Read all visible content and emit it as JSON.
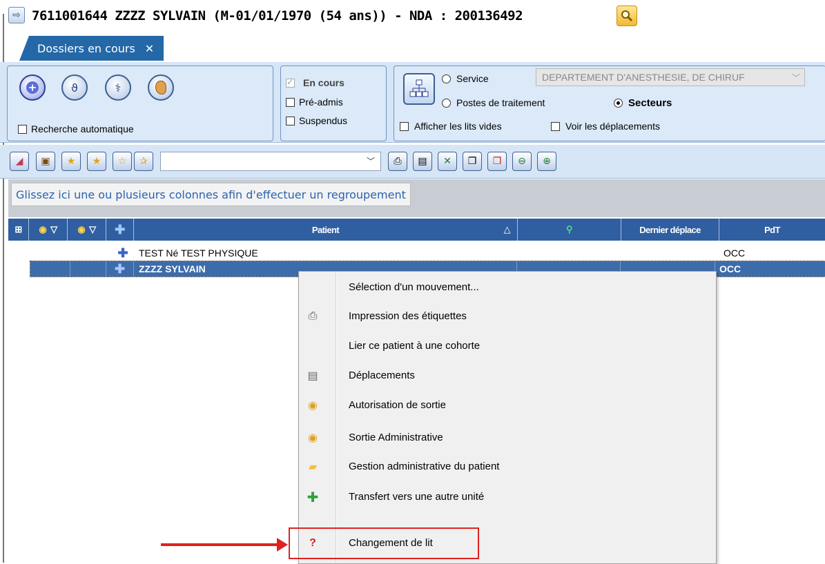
{
  "header": {
    "title": "7611001644 ZZZZ SYLVAIN (M-01/01/1970 (54 ans)) - NDA : 200136492"
  },
  "tab": {
    "label": "Dossiers en cours",
    "close": "✕"
  },
  "filters": {
    "auto_search_label": "Recherche automatique",
    "status": {
      "en_cours": "En cours",
      "pre_admis": "Pré-admis",
      "suspendus": "Suspendus"
    },
    "scope": {
      "service": "Service",
      "postes": "Postes de traitement",
      "secteurs": "Secteurs",
      "service_value": "DEPARTEMENT D'ANESTHESIE, DE CHIRUF"
    },
    "empty_beds_label": "Afficher les lits vides",
    "moves_label": "Voir les déplacements"
  },
  "grid": {
    "group_hint": "Glissez ici une ou plusieurs colonnes afin d'effectuer un regroupement",
    "columns": {
      "patient": "Patient",
      "sort": "△",
      "last_move": "Dernier déplace",
      "pdt": "PdT"
    },
    "rows": [
      {
        "patient": "TEST Né TEST PHYSIQUE",
        "pdt": "OCC"
      },
      {
        "patient": "ZZZZ SYLVAIN",
        "pdt": "OCC"
      }
    ]
  },
  "context_menu": {
    "items": [
      {
        "label": "Sélection d'un mouvement...",
        "icon": "none"
      },
      {
        "label": "Impression des étiquettes",
        "icon": "printer-icon"
      },
      {
        "label": "Lier ce patient à une cohorte",
        "icon": "none"
      },
      {
        "label": "Déplacements",
        "icon": "document-icon"
      },
      {
        "label": "Autorisation de sortie",
        "icon": "exit-authorization-icon"
      },
      {
        "label": "Sortie Administrative",
        "icon": "admin-exit-icon"
      },
      {
        "label": "Gestion administrative du patient",
        "icon": "folder-icon"
      },
      {
        "label": "Transfert vers une autre unité",
        "icon": "green-plus-icon"
      },
      {
        "label": "Changement de lit",
        "icon": "bed-change-icon"
      }
    ]
  },
  "colors": {
    "header_blue": "#2f5fa1",
    "selected_row": "#3d6cab",
    "panel_bg": "#d6e6f7",
    "annotation_red": "#e02020"
  }
}
